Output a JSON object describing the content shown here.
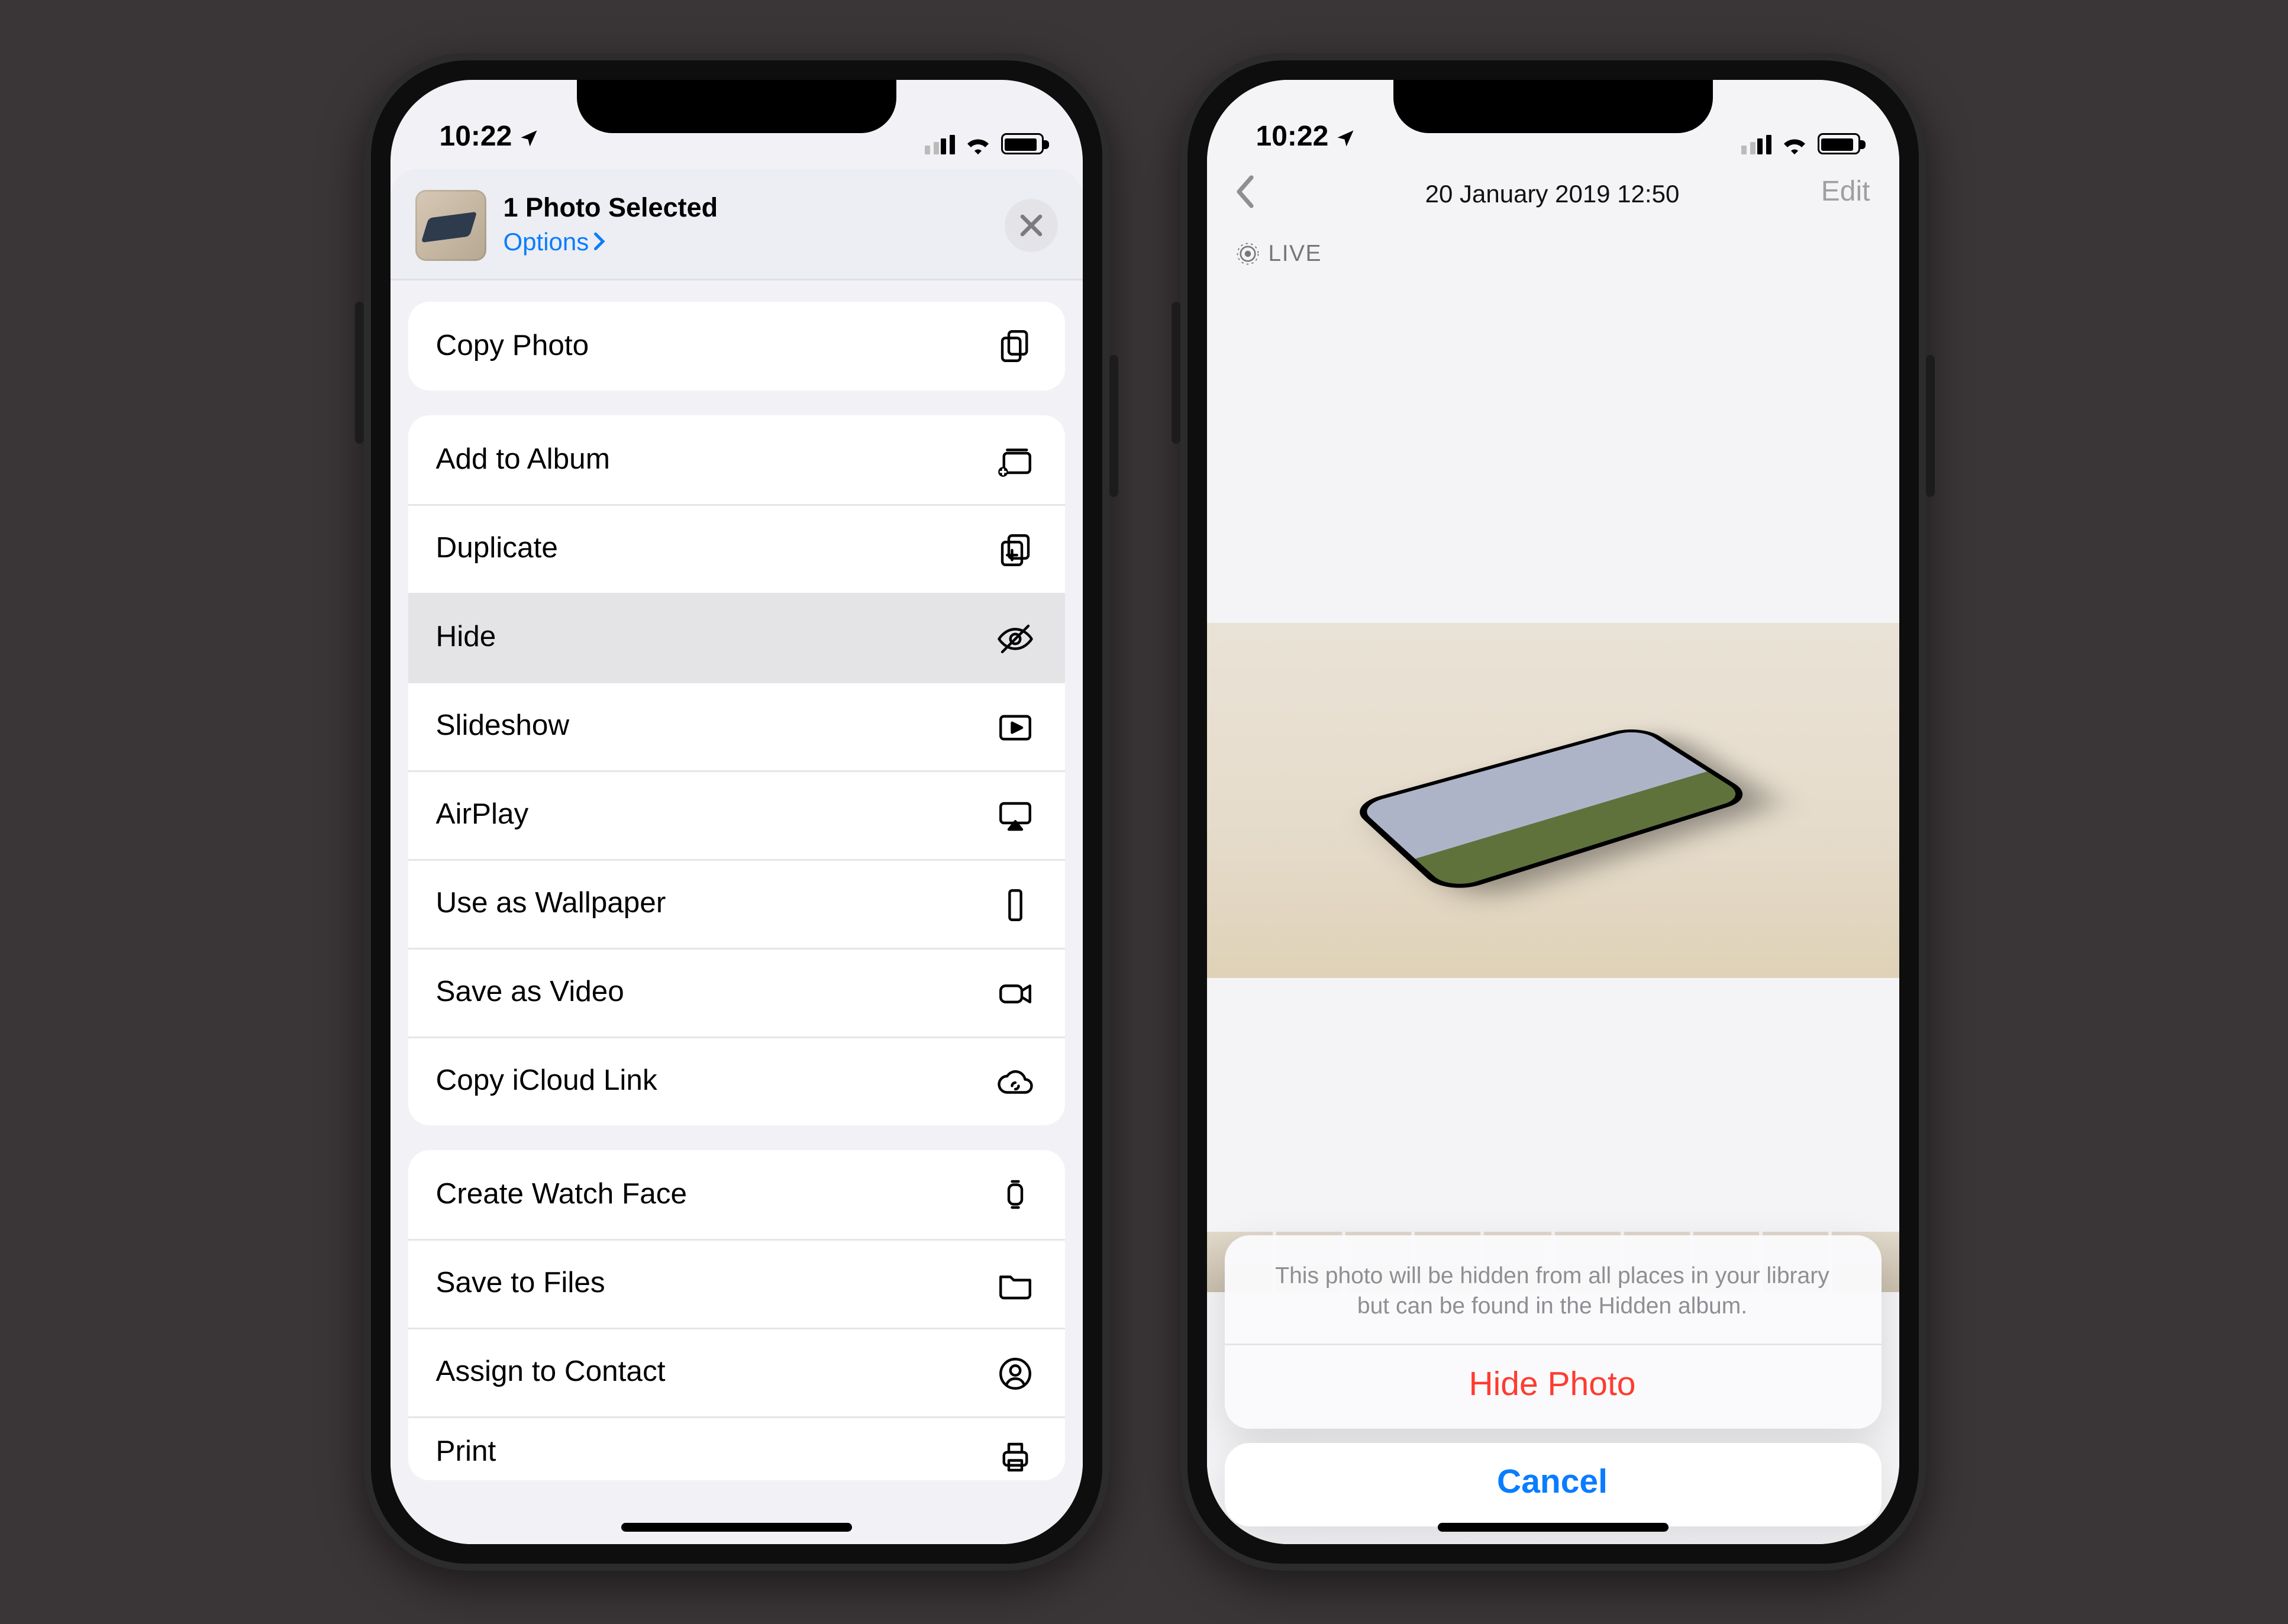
{
  "status": {
    "time": "10:22"
  },
  "share_sheet": {
    "title": "1 Photo Selected",
    "options_link": "Options",
    "groups": [
      {
        "rows": [
          {
            "label": "Copy Photo",
            "icon": "copy-docs-icon"
          }
        ]
      },
      {
        "rows": [
          {
            "label": "Add to Album",
            "icon": "albums-add-icon"
          },
          {
            "label": "Duplicate",
            "icon": "duplicate-icon"
          },
          {
            "label": "Hide",
            "icon": "eye-slash-icon",
            "highlighted": true
          },
          {
            "label": "Slideshow",
            "icon": "play-rect-icon"
          },
          {
            "label": "AirPlay",
            "icon": "airplay-icon"
          },
          {
            "label": "Use as Wallpaper",
            "icon": "phone-outline-icon"
          },
          {
            "label": "Save as Video",
            "icon": "video-icon"
          },
          {
            "label": "Copy iCloud Link",
            "icon": "cloud-link-icon"
          }
        ]
      },
      {
        "rows": [
          {
            "label": "Create Watch Face",
            "icon": "watch-icon"
          },
          {
            "label": "Save to Files",
            "icon": "folder-icon"
          },
          {
            "label": "Assign to Contact",
            "icon": "contact-icon"
          },
          {
            "label": "Print",
            "icon": "printer-icon",
            "partial": true
          }
        ]
      }
    ]
  },
  "photo_view": {
    "date_title": "20 January 2019  12:50",
    "edit_label": "Edit",
    "live_label": "LIVE"
  },
  "action_sheet": {
    "message": "This photo will be hidden from all places in your library but can be found in the Hidden album.",
    "primary": "Hide Photo",
    "cancel": "Cancel"
  }
}
